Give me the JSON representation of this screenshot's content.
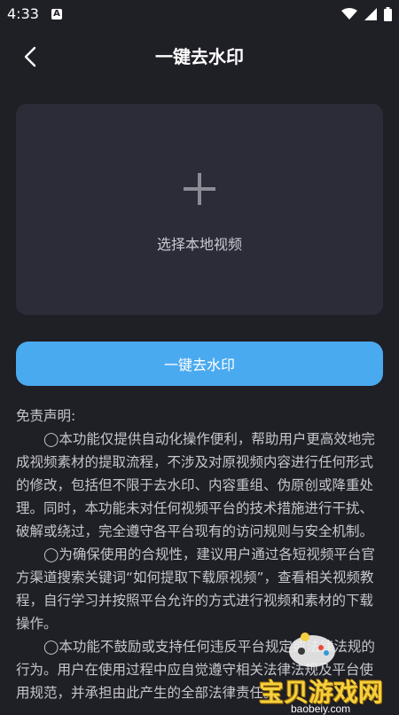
{
  "status_bar": {
    "time": "4:33",
    "notification_letter": "A"
  },
  "header": {
    "title": "一键去水印"
  },
  "upload": {
    "label": "选择本地视频"
  },
  "actions": {
    "primary_label": "一键去水印"
  },
  "disclaimer": {
    "title": "免责声明:",
    "paragraphs": [
      "◯本功能仅提供自动化操作便利，帮助用户更高效地完成视频素材的提取流程，不涉及对原视频内容进行任何形式的修改，包括但不限于去水印、内容重组、伪原创或降重处理。同时，本功能未对任何视频平台的技术措施进行干扰、破解或绕过，完全遵守各平台现有的访问规则与安全机制。",
      "◯为确保使用的合规性，建议用户通过各短视频平台官方渠道搜索关键词“如何提取下载原视频”，查看相关视频教程，自行学习并按照平台允许的方式进行视频和素材的下载操作。",
      "◯本功能不鼓励或支持任何违反平台规定或法律法规的行为。用户在使用过程中应自觉遵守相关法律法规及平台使用规范，并承担由此产生的全部法律责任。"
    ]
  },
  "watermark": {
    "text": "宝贝游戏网",
    "domain": "baobeiy.com"
  }
}
